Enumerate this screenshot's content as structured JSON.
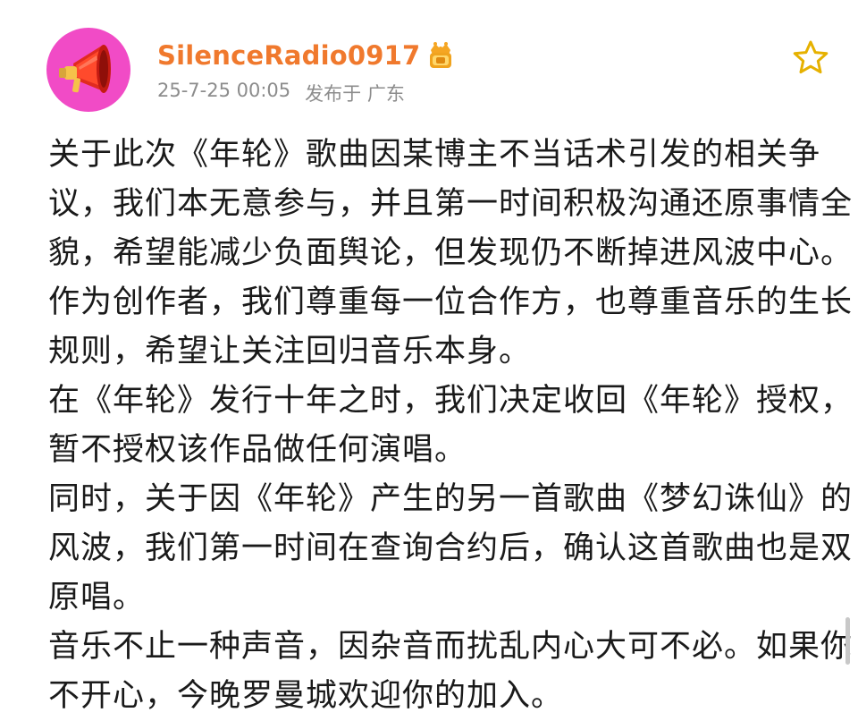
{
  "post": {
    "username": "SilenceRadio0917",
    "timestamp": "25-7-25 00:05",
    "location": "发布于 广东",
    "icons": {
      "avatar": "megaphone-avatar",
      "vip": "vip-crown-badge",
      "favorite": "star-icon"
    },
    "colors": {
      "username": "#f0792d",
      "avatar_bg": "#f14bc6",
      "meta": "#8c8c8c",
      "star": "#e6b100"
    },
    "lines": [
      "关于此次《年轮》歌曲因某博主不当话术引发的相关争",
      "议，我们本无意参与，并且第一时间积极沟通还原事情全",
      "貌，希望能减少负面舆论，但发现仍不断掉进风波中心。",
      "作为创作者，我们尊重每一位合作方，也尊重音乐的生长",
      "规则，希望让关注回归音乐本身。",
      "在《年轮》发行十年之时，我们决定收回《年轮》授权，",
      "暂不授权该作品做任何演唱。",
      "同时，关于因《年轮》产生的另一首歌曲《梦幻诛仙》的",
      "风波，我们第一时间在查询合约后，确认这首歌曲也是双",
      "原唱。",
      "音乐不止一种声音，因杂音而扰乱内心大可不必。如果你",
      "不开心，今晚罗曼城欢迎你的加入。"
    ]
  }
}
